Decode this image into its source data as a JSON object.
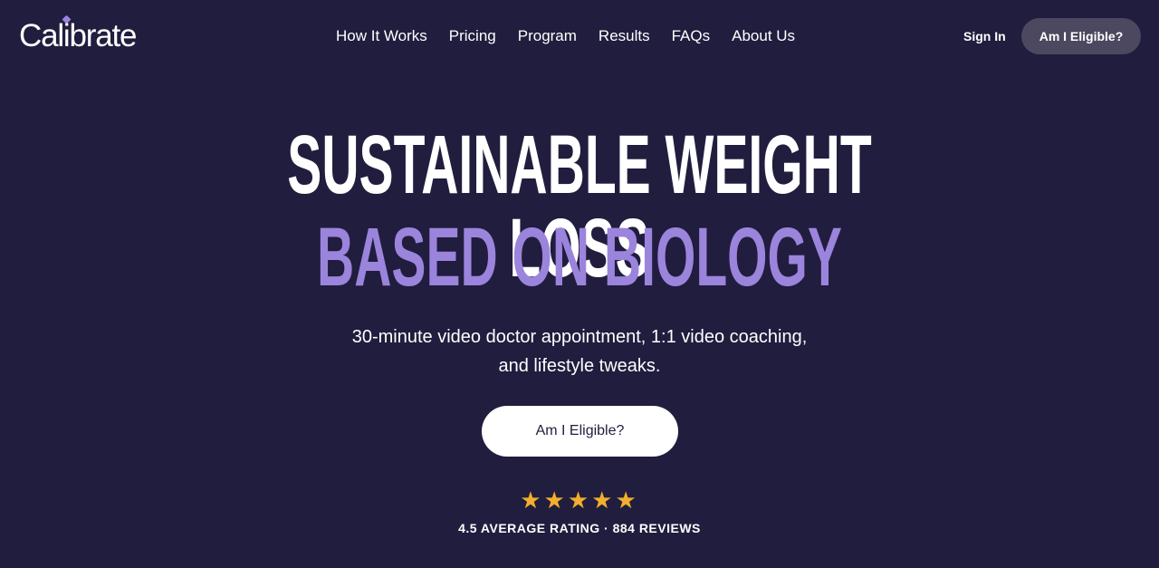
{
  "header": {
    "logo_text": "Calibrate",
    "nav": [
      {
        "label": "How It Works"
      },
      {
        "label": "Pricing"
      },
      {
        "label": "Program"
      },
      {
        "label": "Results"
      },
      {
        "label": "FAQs"
      },
      {
        "label": "About Us"
      }
    ],
    "sign_in": "Sign In",
    "cta": "Am I Eligible?"
  },
  "hero": {
    "headline_line1": "SUSTAINABLE WEIGHT LOSS",
    "headline_line2": "BASED ON BIOLOGY",
    "subtitle_line1": "30-minute video doctor appointment, 1:1 video coaching,",
    "subtitle_line2": "and lifestyle tweaks.",
    "cta": "Am I Eligible?",
    "stars": "★★★★★",
    "rating_text": "4.5 AVERAGE RATING · 884 REVIEWS"
  },
  "colors": {
    "background": "#211d3e",
    "accent_purple": "#9b84dc",
    "star": "#f2ae2d",
    "header_button": "#4c485f"
  }
}
